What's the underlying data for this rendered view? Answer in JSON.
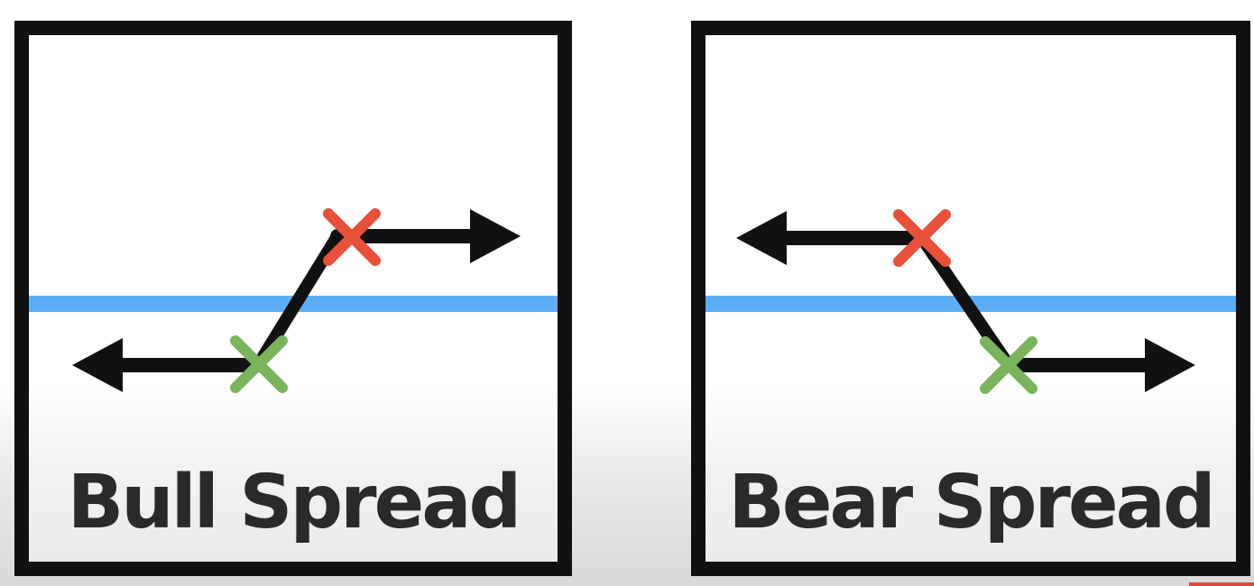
{
  "panels": [
    {
      "id": "bull",
      "label": "Bull Spread"
    },
    {
      "id": "bear",
      "label": "Bear Spread"
    }
  ],
  "colors": {
    "frame": "#111111",
    "payoff_line": "#111111",
    "breakeven_line": "#5aaff5",
    "long_strike_marker": "#7ab55c",
    "short_strike_marker": "#e8503a",
    "label_text": "#2a2a2a"
  },
  "icons": {
    "long_strike": "green-x-icon",
    "short_strike": "red-x-icon",
    "arrow_left": "arrow-left-icon",
    "arrow_right": "arrow-right-icon"
  }
}
